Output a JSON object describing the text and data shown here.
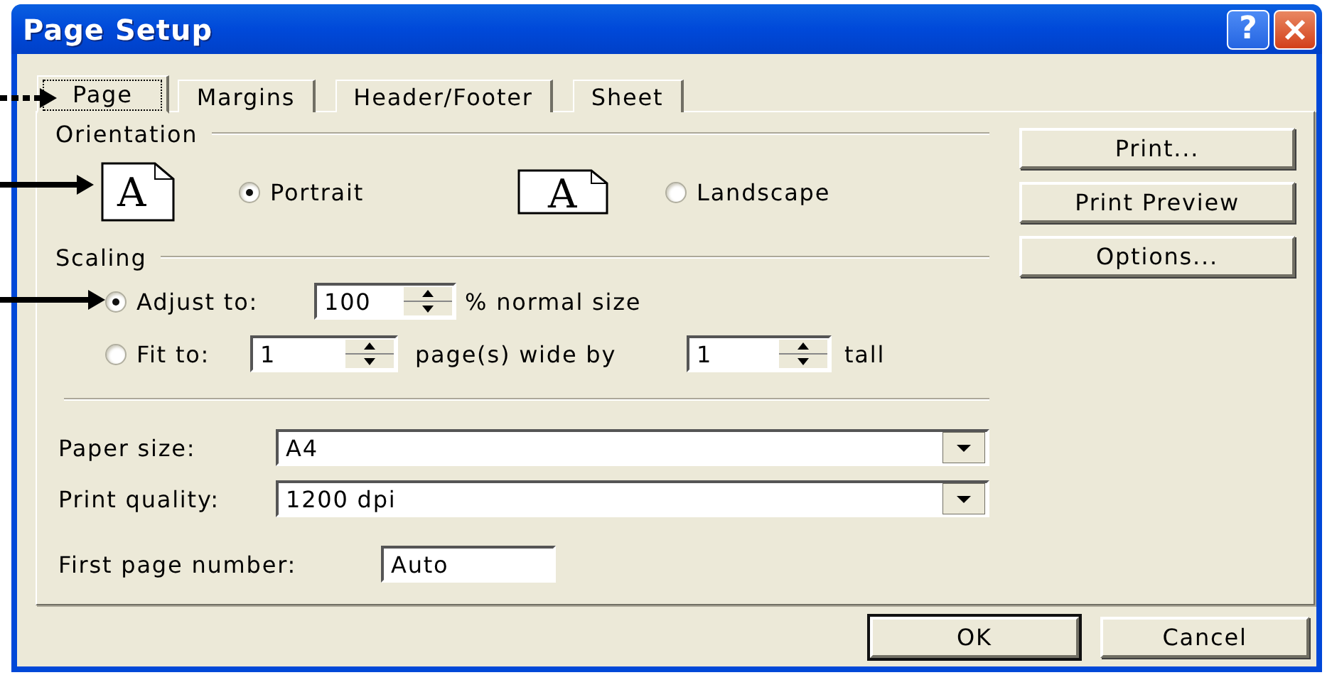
{
  "window": {
    "title": "Page Setup",
    "help_label": "?"
  },
  "tabs": [
    {
      "label": "Page",
      "selected": true
    },
    {
      "label": "Margins",
      "selected": false
    },
    {
      "label": "Header/Footer",
      "selected": false
    },
    {
      "label": "Sheet",
      "selected": false
    }
  ],
  "orientation": {
    "label": "Orientation",
    "options": [
      {
        "kind": "portrait",
        "icon_letter": "A",
        "label": "Portrait",
        "selected": true
      },
      {
        "kind": "landscape",
        "icon_letter": "A",
        "label": "Landscape",
        "selected": false
      }
    ]
  },
  "scaling": {
    "label": "Scaling",
    "adjust": {
      "label": "Adjust to:",
      "selected": true,
      "value": "100",
      "suffix": "% normal size"
    },
    "fit": {
      "label": "Fit to:",
      "selected": false,
      "wide_value": "1",
      "wide_suffix": "page(s) wide by",
      "tall_value": "1",
      "tall_suffix": "tall"
    }
  },
  "paper_size": {
    "label": "Paper size:",
    "value": "A4"
  },
  "print_quality": {
    "label": "Print quality:",
    "value": "1200 dpi"
  },
  "first_page_number": {
    "label": "First page number:",
    "value": "Auto"
  },
  "side_buttons": [
    "Print...",
    "Print Preview",
    "Options..."
  ],
  "buttons": [
    {
      "label": "OK",
      "default": true
    },
    {
      "label": "Cancel",
      "default": false
    }
  ],
  "pointer_arrows": [
    {
      "kind": "dotted"
    },
    {
      "kind": "solid"
    },
    {
      "kind": "solid"
    }
  ]
}
